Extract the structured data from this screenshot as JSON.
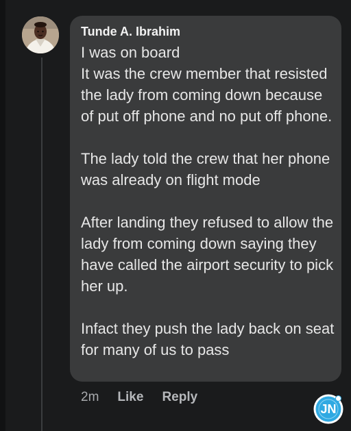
{
  "comment": {
    "author": "Tunde A. Ibrahim",
    "text": "I was on board\nIt was the crew member that resisted the lady from coming down because of put off phone and no put off phone.\n\nThe lady told the crew that her phone was already on flight mode\n\nAfter landing they refused to allow the lady from coming down saying they have called the airport security to pick her up.\n\nInfact they push the lady back on seat for many of us to pass",
    "timestamp": "2m",
    "like_label": "Like",
    "reply_label": "Reply"
  },
  "watermark": {
    "text": "JN",
    "icon": "jn-logo-icon",
    "color": "#31a8e0"
  },
  "colors": {
    "background": "#1a1b1c",
    "bubble": "#3a3b3c",
    "text": "#e7e7e7",
    "muted": "#b0b3b8"
  }
}
